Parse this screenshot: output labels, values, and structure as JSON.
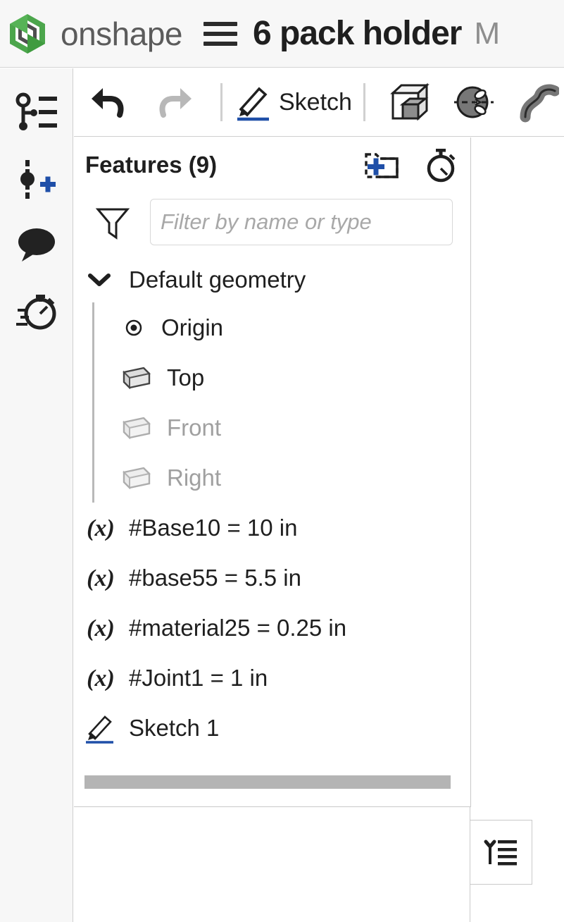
{
  "header": {
    "logo_name": "onshape-logo-icon",
    "brand": "onshape",
    "menu_label": "hamburger-menu",
    "document_title": "6 pack holder",
    "workspace": "M",
    "brand_green": "#4ca64c",
    "title_color": "#1f1f1f"
  },
  "rail": {
    "items": [
      {
        "name": "feature-list-icon",
        "tooltip": "Feature list"
      },
      {
        "name": "add-version-icon",
        "tooltip": "Add version"
      },
      {
        "name": "comment-icon",
        "tooltip": "Comments"
      },
      {
        "name": "history-icon",
        "tooltip": "History"
      }
    ],
    "accent_blue": "#1f4fa8"
  },
  "toolbar": {
    "undo_label": "Undo",
    "redo_label": "Redo",
    "sketch_label": "Sketch",
    "items": [
      {
        "name": "undo-icon",
        "label": "Undo",
        "enabled": true
      },
      {
        "name": "redo-icon",
        "label": "Redo",
        "enabled": false
      },
      {
        "name": "sketch-icon",
        "label": "Sketch",
        "enabled": true
      },
      {
        "name": "extrude-icon",
        "label": "Extrude",
        "enabled": true
      },
      {
        "name": "revolve-icon",
        "label": "Revolve",
        "enabled": true
      },
      {
        "name": "sweep-icon",
        "label": "Sweep",
        "enabled": true
      }
    ],
    "sketch_underline_color": "#1f4fa8"
  },
  "features": {
    "title": "Features (9)",
    "count": 9,
    "new_folder_label": "New folder",
    "rollback_label": "Rollback",
    "filter_placeholder": "Filter by name or type",
    "filter_value": "",
    "group": {
      "label": "Default geometry",
      "expanded": true,
      "children": [
        {
          "label": "Origin",
          "icon": "origin-icon",
          "hidden": false
        },
        {
          "label": "Top",
          "icon": "plane-icon",
          "hidden": false
        },
        {
          "label": "Front",
          "icon": "plane-icon",
          "hidden": true
        },
        {
          "label": "Right",
          "icon": "plane-icon",
          "hidden": true
        }
      ]
    },
    "items": [
      {
        "label": "#Base10 = 10 in",
        "icon": "variable-icon"
      },
      {
        "label": "#base55 = 5.5 in",
        "icon": "variable-icon"
      },
      {
        "label": "#material25 = 0.25 in",
        "icon": "variable-icon"
      },
      {
        "label": "#Joint1 = 1 in",
        "icon": "variable-icon"
      },
      {
        "label": "Sketch 1",
        "icon": "sketch-icon"
      }
    ],
    "rollback_bar_name": "rollback-bar"
  },
  "flyout": {
    "toggle_name": "feature-tree-toggle-icon",
    "tooltip": "Show/hide feature list"
  }
}
